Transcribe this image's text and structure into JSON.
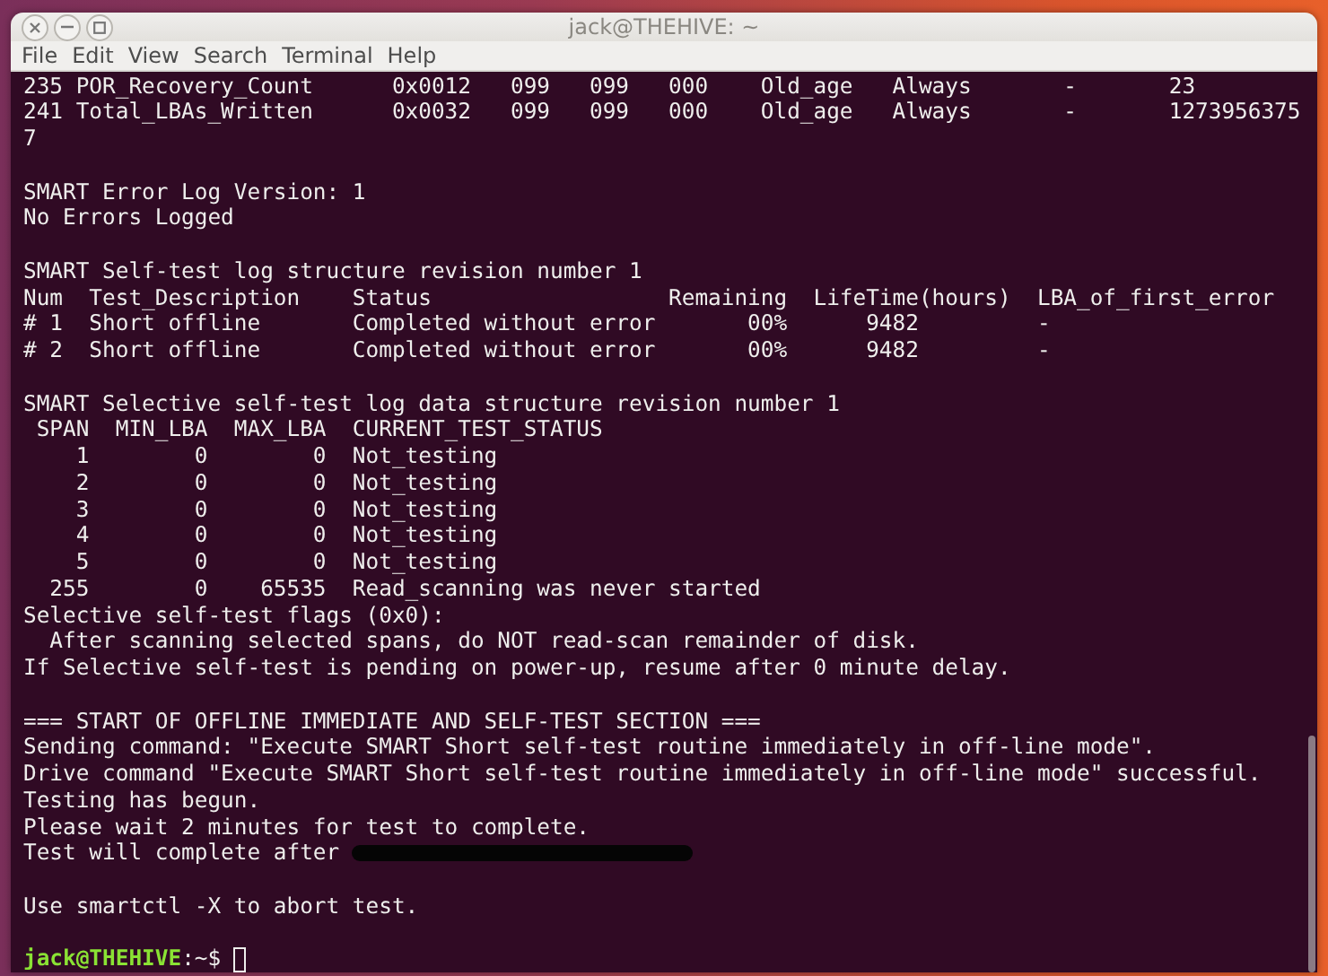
{
  "window": {
    "title": "jack@THEHIVE: ~"
  },
  "menu": [
    "File",
    "Edit",
    "View",
    "Search",
    "Terminal",
    "Help"
  ],
  "blocks": [
    [
      {
        "text": "235 POR_Recovery_Count      0x0012   099   099   000    Old_age   Always       -       23",
        "redacted": false
      },
      {
        "text": "241 Total_LBAs_Written      0x0032   099   099   000    Old_age   Always       -       1273956375",
        "redacted": false
      },
      {
        "text": "7",
        "redacted": false
      }
    ],
    [
      {
        "text": "SMART Error Log Version: 1",
        "redacted": false
      },
      {
        "text": "No Errors Logged",
        "redacted": false
      }
    ],
    [
      {
        "text": "SMART Self-test log structure revision number 1",
        "redacted": false
      },
      {
        "text": "Num  Test_Description    Status                  Remaining  LifeTime(hours)  LBA_of_first_error",
        "redacted": false
      },
      {
        "text": "# 1  Short offline       Completed without error       00%      9482         -",
        "redacted": false
      },
      {
        "text": "# 2  Short offline       Completed without error       00%      9482         -",
        "redacted": false
      }
    ],
    [
      {
        "text": "SMART Selective self-test log data structure revision number 1",
        "redacted": false
      },
      {
        "text": " SPAN  MIN_LBA  MAX_LBA  CURRENT_TEST_STATUS",
        "redacted": false
      },
      {
        "text": "    1        0        0  Not_testing",
        "redacted": false
      },
      {
        "text": "    2        0        0  Not_testing",
        "redacted": false
      },
      {
        "text": "    3        0        0  Not_testing",
        "redacted": false
      },
      {
        "text": "    4        0        0  Not_testing",
        "redacted": false
      },
      {
        "text": "    5        0        0  Not_testing",
        "redacted": false
      },
      {
        "text": "  255        0    65535  Read_scanning was never started",
        "redacted": false
      },
      {
        "text": "Selective self-test flags (0x0):",
        "redacted": false
      },
      {
        "text": "  After scanning selected spans, do NOT read-scan remainder of disk.",
        "redacted": false
      },
      {
        "text": "If Selective self-test is pending on power-up, resume after 0 minute delay.",
        "redacted": false
      }
    ],
    [
      {
        "text": "=== START OF OFFLINE IMMEDIATE AND SELF-TEST SECTION ===",
        "redacted": false
      },
      {
        "text": "Sending command: \"Execute SMART Short self-test routine immediately in off-line mode\".",
        "redacted": false
      },
      {
        "text": "Drive command \"Execute SMART Short self-test routine immediately in off-line mode\" successful.",
        "redacted": false
      },
      {
        "text": "Testing has begun.",
        "redacted": false
      },
      {
        "text": "Please wait 2 minutes for test to complete.",
        "redacted": false
      },
      {
        "text": "Test will complete after",
        "redacted": true
      }
    ],
    [
      {
        "text": "Use smartctl -X to abort test.",
        "redacted": false
      }
    ]
  ],
  "prompt": {
    "user_host": "jack@THEHIVE",
    "path": ":~$"
  }
}
